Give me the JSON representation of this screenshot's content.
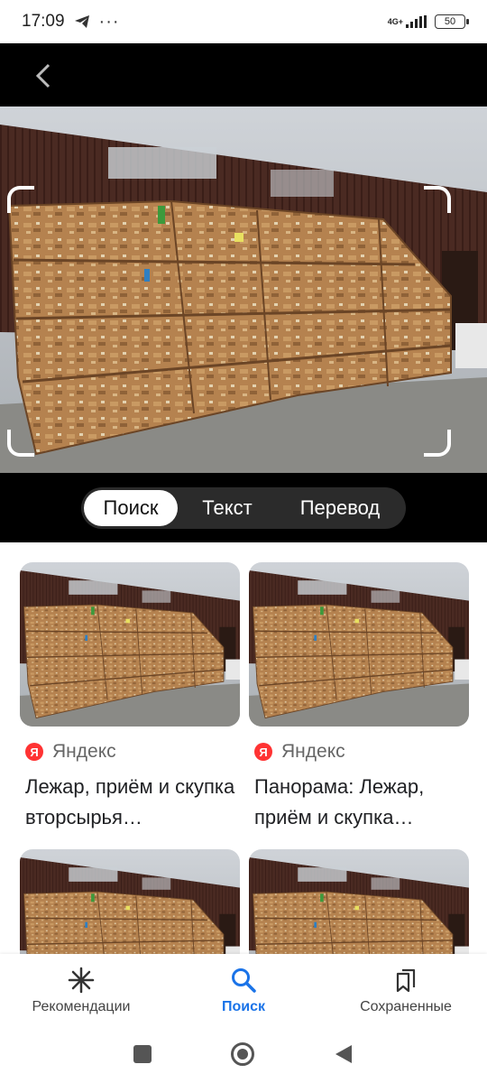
{
  "status_bar": {
    "time": "17:09",
    "network": "4G+",
    "battery": "50"
  },
  "viewer": {
    "tabs": [
      {
        "label": "Поиск",
        "active": true
      },
      {
        "label": "Текст",
        "active": false
      },
      {
        "label": "Перевод",
        "active": false
      }
    ]
  },
  "results": [
    {
      "source": "Яндекс",
      "logo": "Я",
      "title": "Лежар, приём и скупка вторсырья…"
    },
    {
      "source": "Яндекс",
      "logo": "Я",
      "title": "Панорама: Лежар, приём и скупка…"
    }
  ],
  "bottom_nav": {
    "items": [
      {
        "label": "Рекомендации",
        "icon": "asterisk-icon",
        "active": false
      },
      {
        "label": "Поиск",
        "icon": "search-icon",
        "active": true
      },
      {
        "label": "Сохраненные",
        "icon": "bookmarks-icon",
        "active": false
      }
    ]
  },
  "colors": {
    "accent": "#1a73e8",
    "yandex": "#ff3333"
  }
}
